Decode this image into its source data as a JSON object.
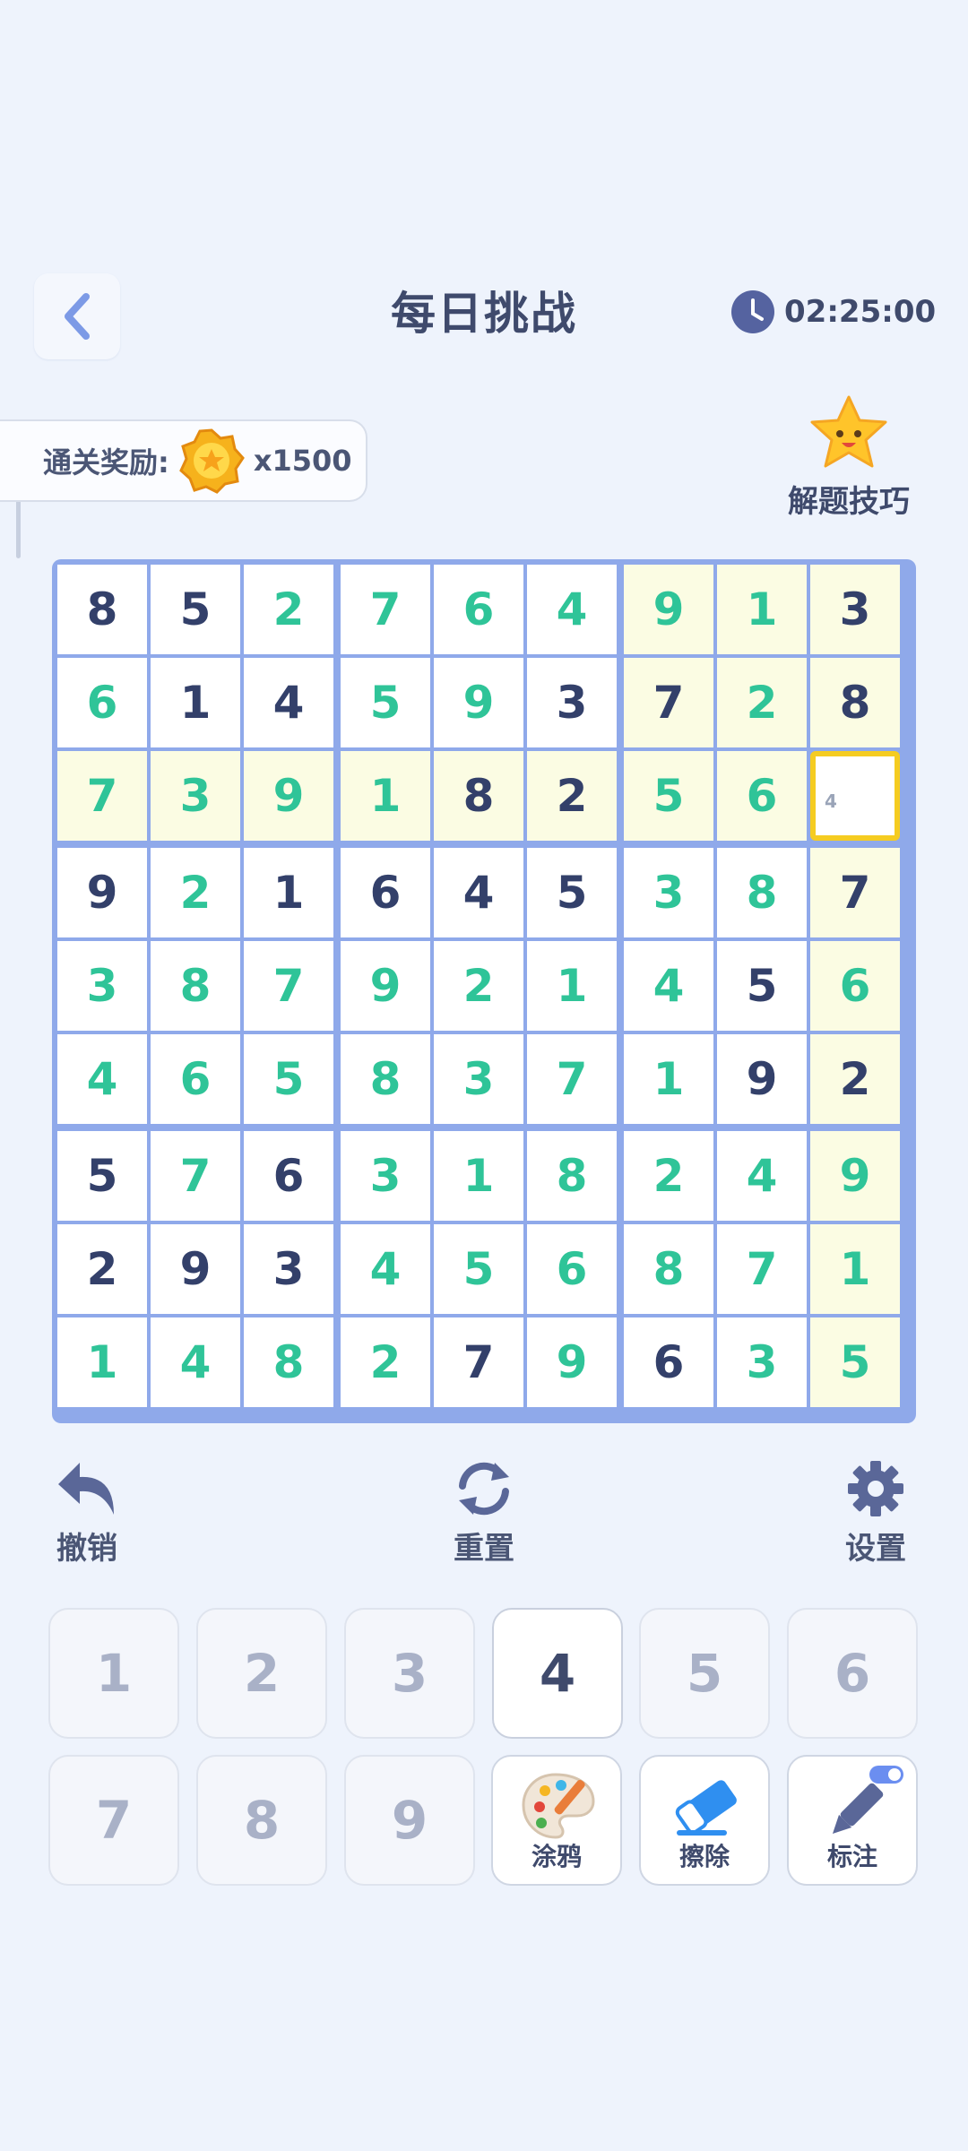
{
  "header": {
    "title": "每日挑战",
    "timer": "02:25:00"
  },
  "reward": {
    "label": "通关奖励:",
    "value": "x1500"
  },
  "tips": {
    "label": "解题技巧"
  },
  "board": {
    "rows": [
      [
        "8",
        "5",
        "2",
        "7",
        "6",
        "4",
        "9",
        "1",
        "3"
      ],
      [
        "6",
        "1",
        "4",
        "5",
        "9",
        "3",
        "7",
        "2",
        "8"
      ],
      [
        "7",
        "3",
        "9",
        "1",
        "8",
        "2",
        "5",
        "6",
        ""
      ],
      [
        "9",
        "2",
        "1",
        "6",
        "4",
        "5",
        "3",
        "8",
        "7"
      ],
      [
        "3",
        "8",
        "7",
        "9",
        "2",
        "1",
        "4",
        "5",
        "6"
      ],
      [
        "4",
        "6",
        "5",
        "8",
        "3",
        "7",
        "1",
        "9",
        "2"
      ],
      [
        "5",
        "7",
        "6",
        "3",
        "1",
        "8",
        "2",
        "4",
        "9"
      ],
      [
        "2",
        "9",
        "3",
        "4",
        "5",
        "6",
        "8",
        "7",
        "1"
      ],
      [
        "1",
        "4",
        "8",
        "2",
        "7",
        "9",
        "6",
        "3",
        "5"
      ]
    ],
    "selected_note": "4"
  },
  "actions": {
    "undo": "撤销",
    "reset": "重置",
    "settings": "设置"
  },
  "keypad": {
    "numbers": [
      "1",
      "2",
      "3",
      "4",
      "5",
      "6",
      "7",
      "8",
      "9"
    ],
    "active": "4"
  },
  "tools": {
    "doodle": "涂鸦",
    "erase": "擦除",
    "mark": "标注"
  },
  "colors": {
    "accent_grid": "#8fa9ea",
    "highlight": "#fbfce3",
    "selected_border": "#f5cc21",
    "user_digit": "#2fc498",
    "given_digit": "#33406a"
  }
}
